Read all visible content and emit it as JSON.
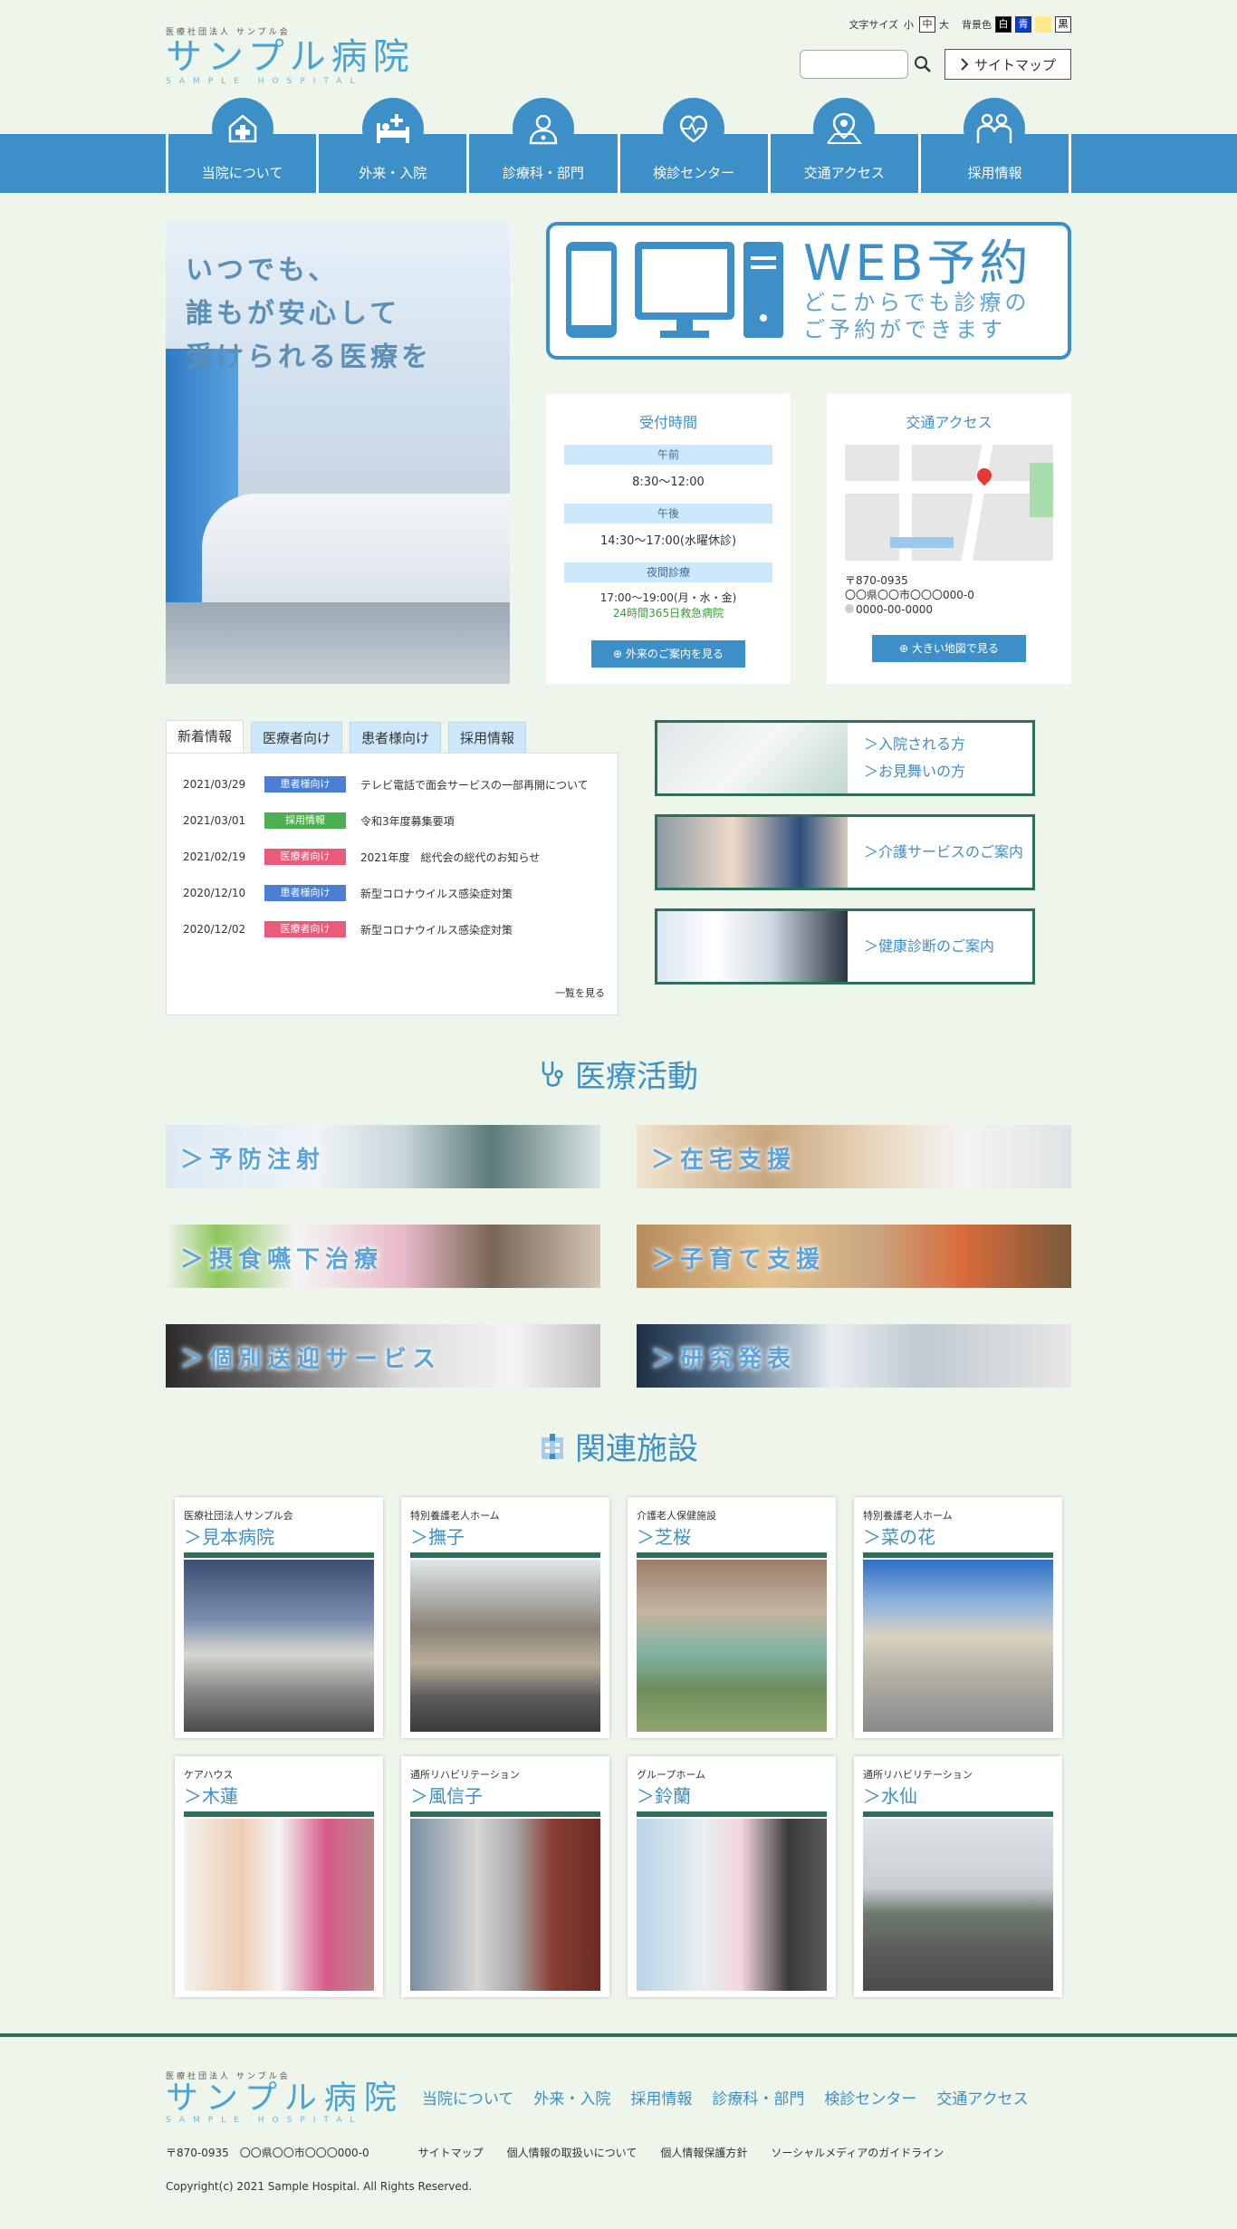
{
  "header": {
    "logo_sub": "医療社団法人 サンプル会",
    "logo_main": "サンプル病院",
    "logo_en": "SAMPLE HOSPITAL",
    "font_size_label": "文字サイズ",
    "font_sizes": [
      "小",
      "中",
      "大"
    ],
    "bg_label": "背景色",
    "bg_options": [
      "白",
      "青",
      "",
      "黒"
    ],
    "search_placeholder": "",
    "sitemap": "サイトマップ"
  },
  "nav": [
    {
      "label": "当院について",
      "icon": "hospital-icon"
    },
    {
      "label": "外来・入院",
      "icon": "bed-icon"
    },
    {
      "label": "診療科・部門",
      "icon": "doctor-icon"
    },
    {
      "label": "検診センター",
      "icon": "heart-pulse-icon"
    },
    {
      "label": "交通アクセス",
      "icon": "map-pin-icon"
    },
    {
      "label": "採用情報",
      "icon": "people-icon"
    }
  ],
  "hero": {
    "lines": [
      "いつでも、",
      "誰もが安心して",
      "受けられる医療を"
    ]
  },
  "web_reservation": {
    "title": "WEB予約",
    "desc1": "どこからでも診療の",
    "desc2": "ご予約ができます"
  },
  "hours": {
    "title": "受付時間",
    "am_label": "午前",
    "am": "8:30～12:00",
    "pm_label": "午後",
    "pm": "14:30～17:00(水曜休診)",
    "night_label": "夜間診療",
    "night": "17:00～19:00(月・水・金)",
    "emergency": "24時間365日救急病院",
    "button": "外来のご案内を見る"
  },
  "access": {
    "title": "交通アクセス",
    "zip": "〒870-0935",
    "address": "〇〇県〇〇市〇〇〇000-0",
    "tel": "0000-00-0000",
    "button": "大きい地図で見る"
  },
  "news": {
    "tabs": [
      "新着情報",
      "医療者向け",
      "患者様向け",
      "採用情報"
    ],
    "items": [
      {
        "date": "2021/03/29",
        "cat": "患者様向け",
        "color": "#4a7fd4",
        "title": "テレビ電話で面会サービスの一部再開について"
      },
      {
        "date": "2021/03/01",
        "cat": "採用情報",
        "color": "#4caf50",
        "title": "令和3年度募集要項"
      },
      {
        "date": "2021/02/19",
        "cat": "医療者向け",
        "color": "#e85b7a",
        "title": "2021年度　総代会の総代のお知らせ"
      },
      {
        "date": "2020/12/10",
        "cat": "患者様向け",
        "color": "#4a7fd4",
        "title": "新型コロナウイルス感染症対策"
      },
      {
        "date": "2020/12/02",
        "cat": "医療者向け",
        "color": "#e85b7a",
        "title": "新型コロナウイルス感染症対策"
      }
    ],
    "more": "一覧を見る"
  },
  "banners": [
    {
      "line1": "＞入院される方",
      "line2": "＞お見舞いの方"
    },
    {
      "line1": "＞介護サービスのご案内",
      "line2": ""
    },
    {
      "line1": "＞健康診断のご案内",
      "line2": ""
    }
  ],
  "activities": {
    "title": "医療活動",
    "items": [
      "＞予防注射",
      "＞在宅支援",
      "＞摂食嚥下治療",
      "＞子育て支援",
      "＞個別送迎サービス",
      "＞研究発表"
    ]
  },
  "facilities": {
    "title": "関連施設",
    "items": [
      {
        "sub": "医療社団法人サンプル会",
        "name": "＞見本病院"
      },
      {
        "sub": "特別養護老人ホーム",
        "name": "＞撫子"
      },
      {
        "sub": "介護老人保健施設",
        "name": "＞芝桜"
      },
      {
        "sub": "特別養護老人ホーム",
        "name": "＞菜の花"
      },
      {
        "sub": "ケアハウス",
        "name": "＞木蓮"
      },
      {
        "sub": "通所リハビリテーション",
        "name": "＞風信子"
      },
      {
        "sub": "グループホーム",
        "name": "＞鈴蘭"
      },
      {
        "sub": "通所リハビリテーション",
        "name": "＞水仙"
      }
    ]
  },
  "footer": {
    "links": [
      "当院について",
      "外来・入院",
      "採用情報",
      "診療科・部門",
      "検診センター",
      "交通アクセス"
    ],
    "address": "〒870-0935　〇〇県〇〇市〇〇〇000-0",
    "links2": [
      "サイトマップ",
      "個人情報の取扱いについて",
      "個人情報保護方針",
      "ソーシャルメディアのガイドライン"
    ],
    "copyright": "Copyright(c) 2021 Sample Hospital. All Rights Reserved."
  }
}
